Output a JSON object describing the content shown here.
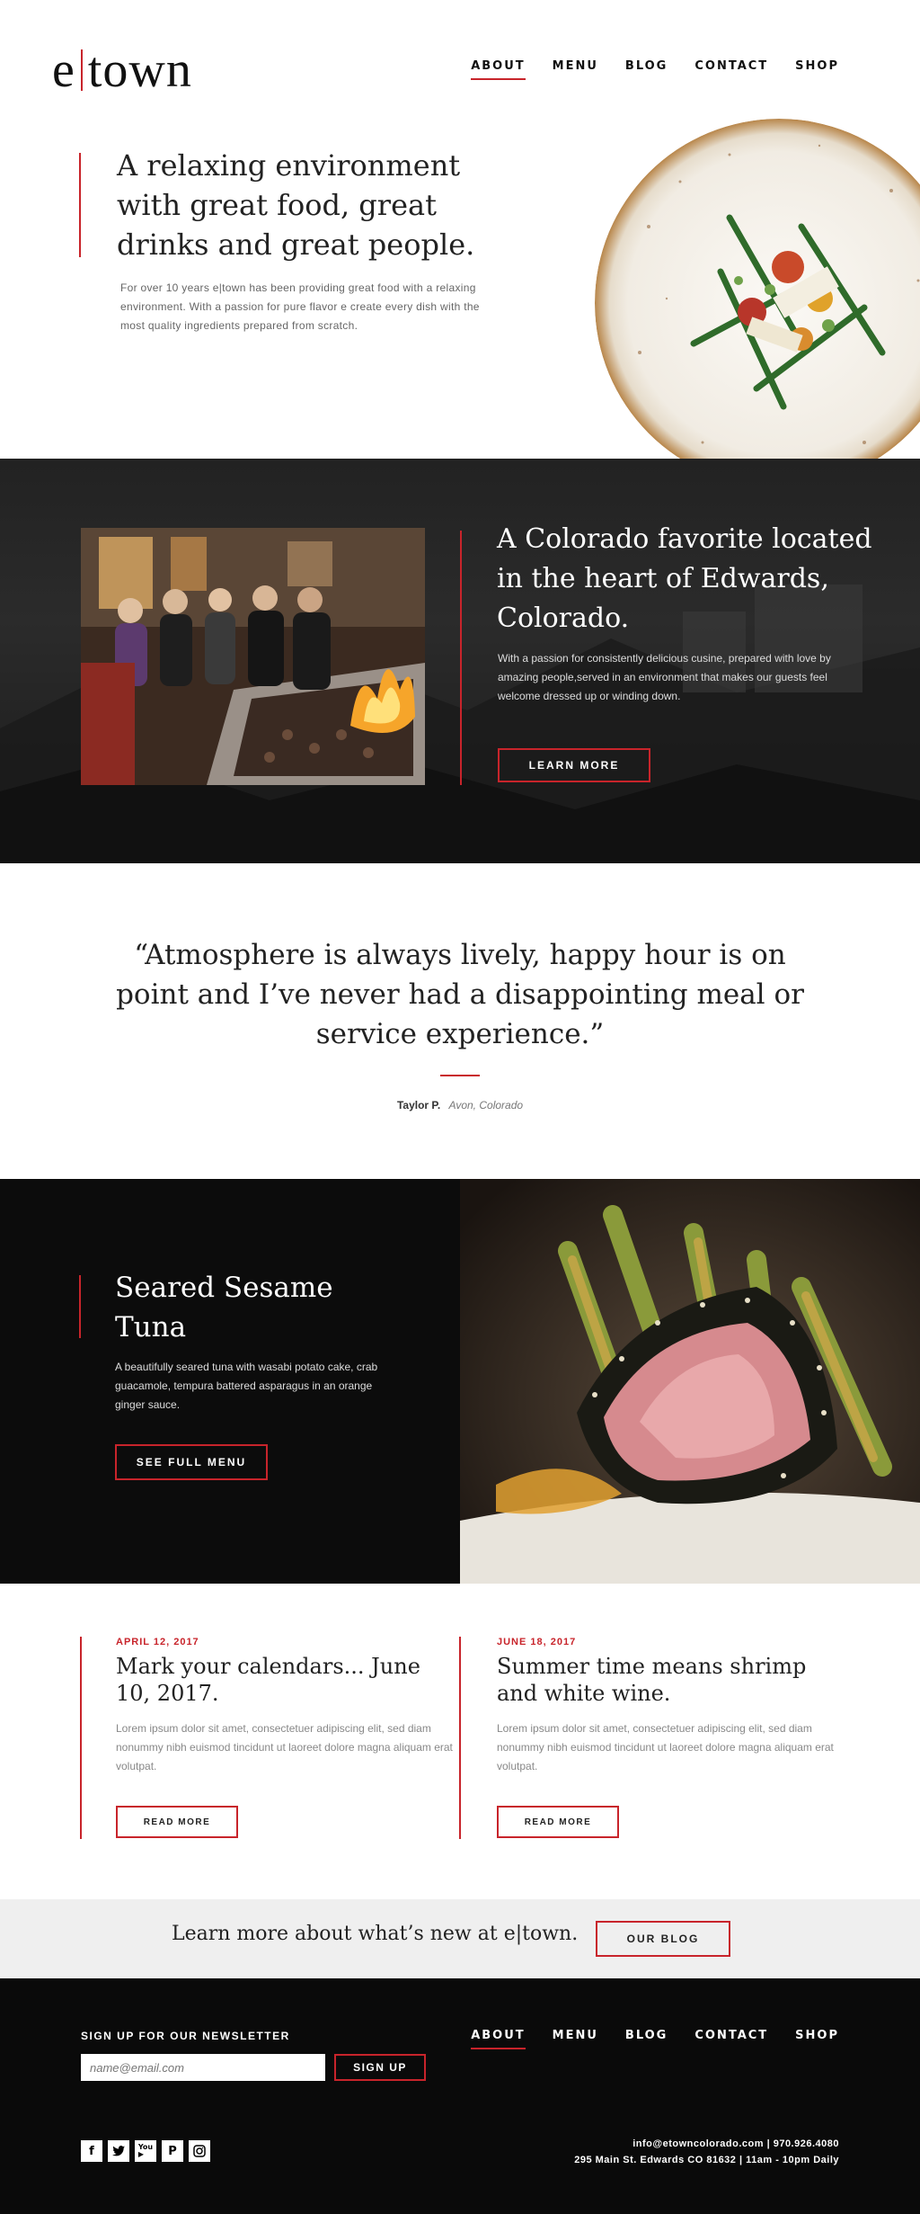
{
  "brand": {
    "logo_left": "e",
    "logo_right": "town"
  },
  "nav": {
    "items": [
      {
        "label": "ABOUT",
        "active": true
      },
      {
        "label": "MENU",
        "active": false
      },
      {
        "label": "BLOG",
        "active": false
      },
      {
        "label": "CONTACT",
        "active": false
      },
      {
        "label": "SHOP",
        "active": false
      }
    ]
  },
  "hero": {
    "title": "A relaxing environment with great food, great drinks and great people.",
    "body": "For over 10 years e|town has been providing great food with a relaxing environment. With a passion for pure flavor e create every dish with the most quality ingredients prepared from scratch."
  },
  "colorado": {
    "title": "A Colorado favorite located in the heart of Edwards, Colorado.",
    "body": "With a passion for consistently delicious cusine, prepared with love by amazing people,served in an environment that makes our guests feel welcome dressed up or winding down.",
    "button": "LEARN MORE"
  },
  "testimonial": {
    "quote": "“Atmosphere is always lively, happy hour is on point and I’ve never had a disappointing meal or service experience.”",
    "author": "Taylor P.",
    "location": "Avon, Colorado"
  },
  "feature": {
    "title": "Seared Sesame Tuna",
    "body": "A beautifully seared tuna with wasabi potato cake, crab guacamole, tempura battered asparagus in an orange ginger sauce.",
    "button": "SEE FULL MENU"
  },
  "news": [
    {
      "date": "APRIL 12, 2017",
      "title": "Mark your calendars... June 10, 2017.",
      "body": "Lorem ipsum dolor sit amet, consectetuer adipiscing elit, sed diam nonummy nibh euismod tincidunt ut laoreet dolore magna aliquam erat volutpat.",
      "button": "READ MORE"
    },
    {
      "date": "JUNE 18, 2017",
      "title": "Summer time means shrimp and white wine.",
      "body": "Lorem ipsum dolor sit amet, consectetuer adipiscing elit, sed diam nonummy nibh euismod tincidunt ut laoreet dolore magna aliquam erat volutpat.",
      "button": "READ MORE"
    }
  ],
  "blog_band": {
    "text": "Learn more about what’s new at e|town.",
    "button": "OUR BLOG"
  },
  "footer": {
    "newsletter_heading": "SIGN UP FOR OUR NEWSLETTER",
    "email_placeholder": "name@email.com",
    "signup_button": "SIGN UP",
    "nav": [
      {
        "label": "ABOUT",
        "active": true
      },
      {
        "label": "MENU",
        "active": false
      },
      {
        "label": "BLOG",
        "active": false
      },
      {
        "label": "CONTACT",
        "active": false
      },
      {
        "label": "SHOP",
        "active": false
      }
    ],
    "social": [
      "facebook-icon",
      "twitter-icon",
      "youtube-icon",
      "pinterest-icon",
      "instagram-icon"
    ],
    "contact_line1": "info@etowncolorado.com | 970.926.4080",
    "contact_line2": "295 Main St. Edwards CO 81632 | 11am - 10pm Daily"
  },
  "colors": {
    "accent": "#c8242b",
    "dark": "#0a0a0a",
    "band": "#efefef"
  }
}
